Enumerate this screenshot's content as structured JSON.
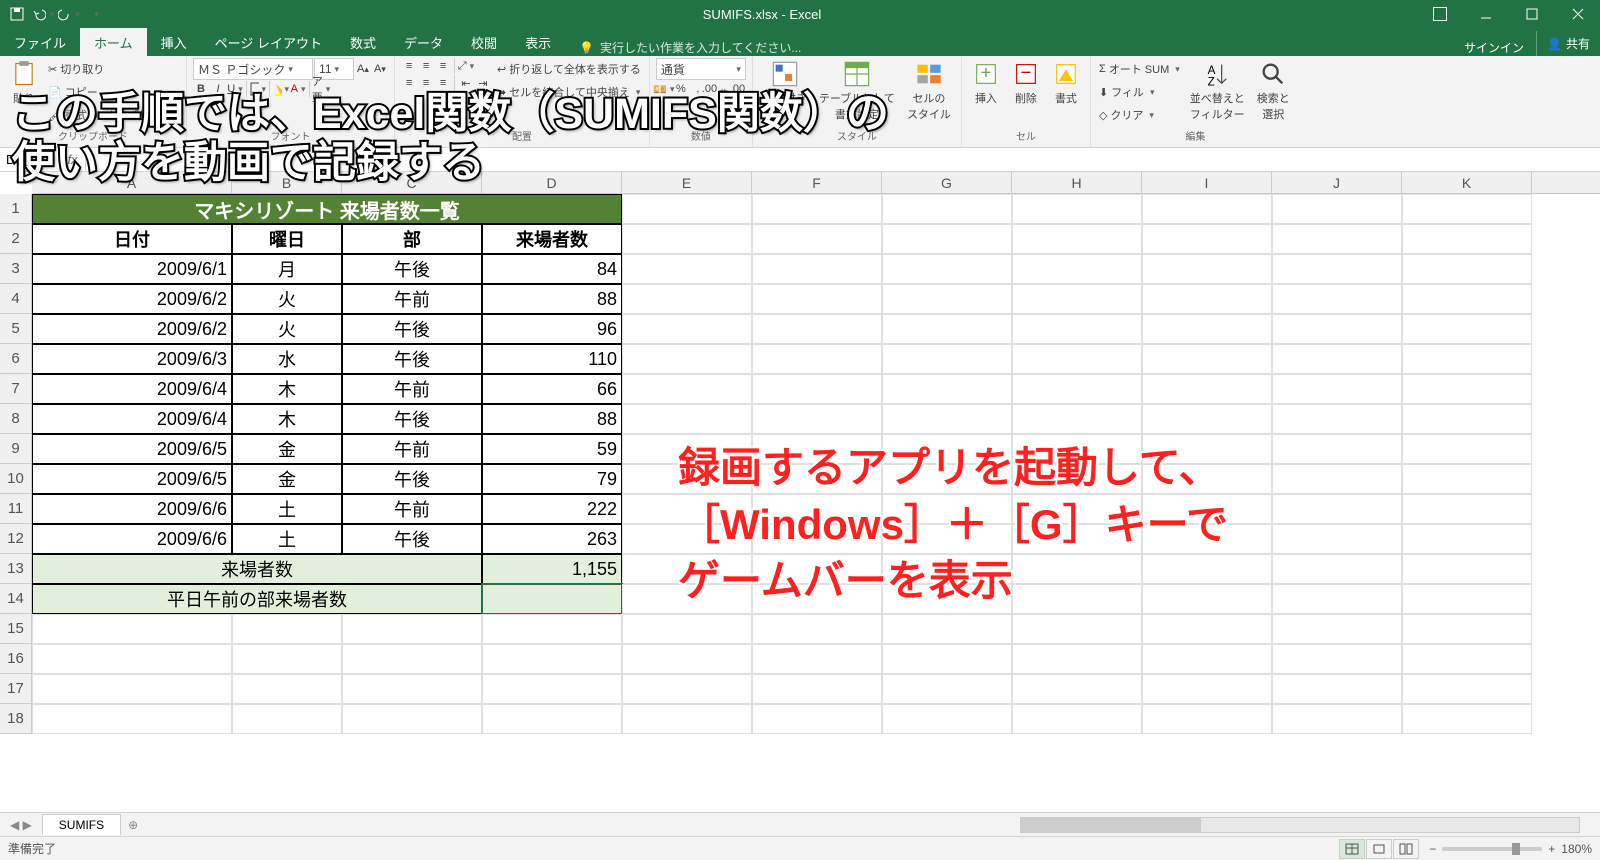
{
  "title": "SUMIFS.xlsx - Excel",
  "qat": {
    "save": "保存",
    "undo": "元に戻す",
    "redo": "やり直し"
  },
  "tabs": {
    "file": "ファイル",
    "home": "ホーム",
    "insert": "挿入",
    "pagelayout": "ページ レイアウト",
    "formulas": "数式",
    "data": "データ",
    "review": "校閲",
    "view": "表示"
  },
  "tellme": "実行したい作業を入力してください...",
  "signin": "サインイン",
  "share": "共有",
  "ribbon": {
    "clipboard": {
      "paste": "貼り",
      "cut": "切り取り",
      "copy": "コピー",
      "formatpainter": "書式のコピー/貼り付け",
      "label": "クリップボード"
    },
    "font": {
      "name": "ＭＳ Ｐゴシック",
      "size": "11",
      "label": "フォント"
    },
    "align": {
      "wrap": "折り返して全体を表示する",
      "merge": "セルを結合して中央揃え",
      "label": "配置"
    },
    "number": {
      "format": "通貨",
      "label": "数値"
    },
    "styles": {
      "condfmt1": "条件付き",
      "condfmt2": "書式",
      "table1": "テーブルとして",
      "table2": "書式設定",
      "cellstyle1": "セルの",
      "cellstyle2": "スタイル",
      "label": "スタイル"
    },
    "cells": {
      "insert": "挿入",
      "delete": "削除",
      "format": "書式",
      "label": "セル"
    },
    "editing": {
      "autosum": "オート SUM",
      "fill": "フィル",
      "clear": "クリア",
      "sort1": "並べ替えと",
      "sort2": "フィルター",
      "find1": "検索と",
      "find2": "選択",
      "label": "編集"
    }
  },
  "namebox": "D",
  "fx": "fx",
  "columns": [
    "A",
    "B",
    "C",
    "D",
    "E",
    "F",
    "G",
    "H",
    "I",
    "J",
    "K"
  ],
  "rownums": [
    "1",
    "2",
    "3",
    "4",
    "5",
    "6",
    "7",
    "8",
    "9",
    "10",
    "11",
    "12",
    "13",
    "14",
    "15",
    "16",
    "17",
    "18"
  ],
  "table": {
    "title": "マキシリゾート 来場者数一覧",
    "headers": {
      "date": "日付",
      "dow": "曜日",
      "part": "部",
      "visitors": "来場者数"
    },
    "rows": [
      {
        "date": "2009/6/1",
        "dow": "月",
        "part": "午後",
        "visitors": "84"
      },
      {
        "date": "2009/6/2",
        "dow": "火",
        "part": "午前",
        "visitors": "88"
      },
      {
        "date": "2009/6/2",
        "dow": "火",
        "part": "午後",
        "visitors": "96"
      },
      {
        "date": "2009/6/3",
        "dow": "水",
        "part": "午後",
        "visitors": "110"
      },
      {
        "date": "2009/6/4",
        "dow": "木",
        "part": "午前",
        "visitors": "66"
      },
      {
        "date": "2009/6/4",
        "dow": "木",
        "part": "午後",
        "visitors": "88"
      },
      {
        "date": "2009/6/5",
        "dow": "金",
        "part": "午前",
        "visitors": "59"
      },
      {
        "date": "2009/6/5",
        "dow": "金",
        "part": "午後",
        "visitors": "79"
      },
      {
        "date": "2009/6/6",
        "dow": "土",
        "part": "午前",
        "visitors": "222"
      },
      {
        "date": "2009/6/6",
        "dow": "土",
        "part": "午後",
        "visitors": "263"
      }
    ],
    "total_label": "来場者数",
    "total_value": "1,155",
    "weekday_am_label": "平日午前の部来場者数",
    "weekday_am_value": ""
  },
  "overlay_top": "この手順では、Excel関数（SUMIFS関数）の\n使い方を動画で記録する",
  "overlay_red": "録画するアプリを起動して、\n［Windows］＋［G］キーで\nゲームバーを表示",
  "sheet_tab": "SUMIFS",
  "status": "準備完了",
  "zoom": "180%"
}
